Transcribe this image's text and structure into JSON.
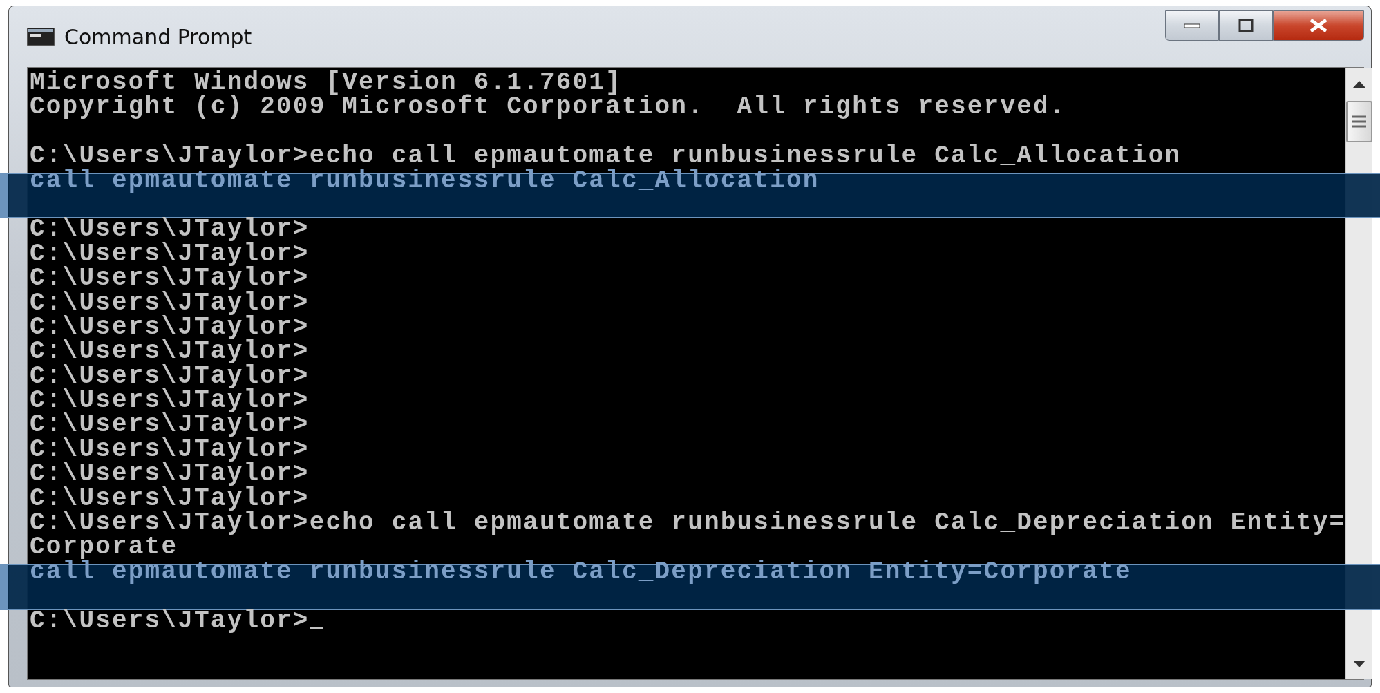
{
  "window": {
    "title": "Command Prompt"
  },
  "console": {
    "blocks": [
      {
        "highlighted": false,
        "cursor": false,
        "lines": [
          "Microsoft Windows [Version 6.1.7601]",
          "Copyright (c) 2009 Microsoft Corporation.  All rights reserved."
        ]
      },
      {
        "highlighted": false,
        "cursor": false,
        "lines": [
          "C:\\Users\\JTaylor>echo call epmautomate runbusinessrule Calc_Allocation"
        ]
      },
      {
        "highlighted": true,
        "cursor": false,
        "lines": [
          "call epmautomate runbusinessrule Calc_Allocation"
        ]
      },
      {
        "highlighted": false,
        "cursor": false,
        "lines": [
          "C:\\Users\\JTaylor>",
          "C:\\Users\\JTaylor>",
          "C:\\Users\\JTaylor>",
          "C:\\Users\\JTaylor>",
          "C:\\Users\\JTaylor>",
          "C:\\Users\\JTaylor>",
          "C:\\Users\\JTaylor>",
          "C:\\Users\\JTaylor>",
          "C:\\Users\\JTaylor>",
          "C:\\Users\\JTaylor>",
          "C:\\Users\\JTaylor>",
          "C:\\Users\\JTaylor>",
          "C:\\Users\\JTaylor>echo call epmautomate runbusinessrule Calc_Depreciation Entity=",
          "Corporate"
        ]
      },
      {
        "highlighted": true,
        "cursor": false,
        "lines": [
          "call epmautomate runbusinessrule Calc_Depreciation Entity=Corporate"
        ]
      },
      {
        "highlighted": false,
        "cursor": true,
        "lines": [
          "C:\\Users\\JTaylor>"
        ]
      }
    ]
  }
}
